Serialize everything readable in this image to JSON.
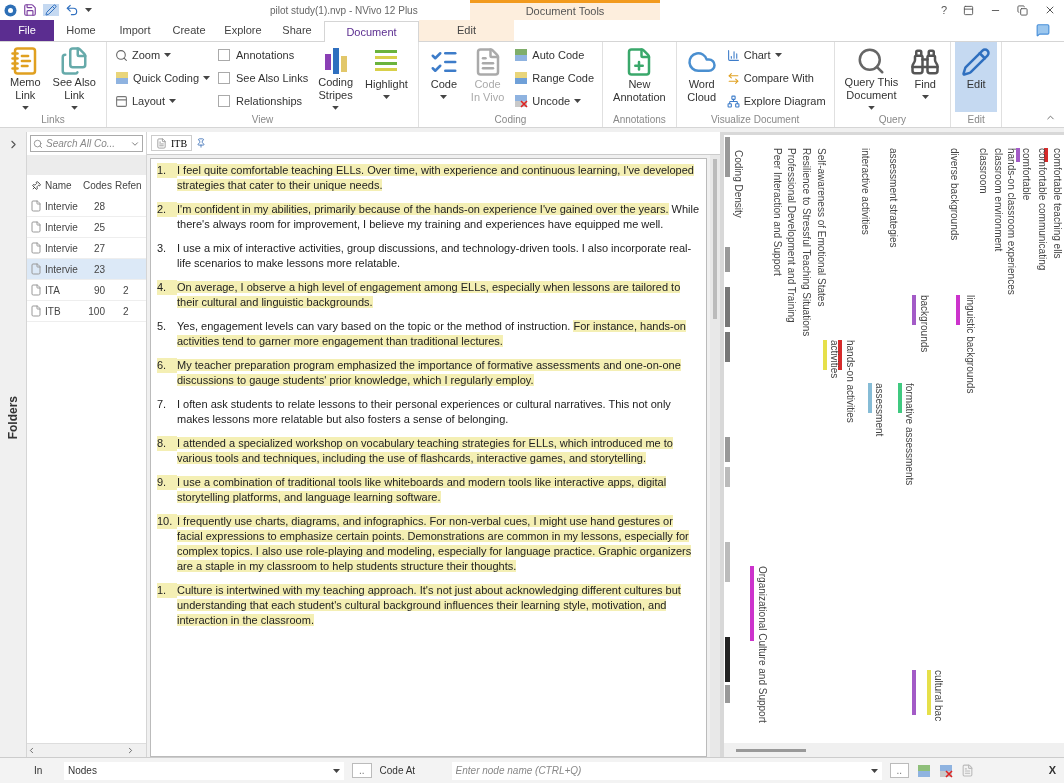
{
  "window": {
    "title": "pilot study(1).nvp - NVivo 12 Plus",
    "context_group": "Document Tools",
    "help": "?"
  },
  "tabs": [
    {
      "label": "File",
      "kind": "file",
      "selected": false
    },
    {
      "label": "Home",
      "kind": "main",
      "selected": false
    },
    {
      "label": "Import",
      "kind": "main",
      "selected": false
    },
    {
      "label": "Create",
      "kind": "main",
      "selected": false
    },
    {
      "label": "Explore",
      "kind": "main",
      "selected": false
    },
    {
      "label": "Share",
      "kind": "main",
      "selected": false
    },
    {
      "label": "Document",
      "kind": "context",
      "selected": true
    },
    {
      "label": "Edit",
      "kind": "context",
      "selected": false
    }
  ],
  "ribbon": {
    "groups": [
      {
        "label": "Links",
        "items": [
          {
            "kind": "large",
            "lines": [
              "Memo",
              "Link"
            ],
            "dropdown": true,
            "disabled": false,
            "active": false
          },
          {
            "kind": "large",
            "lines": [
              "See Also",
              "Link"
            ],
            "dropdown": true,
            "disabled": false,
            "active": false
          }
        ]
      },
      {
        "label": "View",
        "items": [
          {
            "kind": "stack",
            "items": [
              {
                "kind": "small",
                "label": "Zoom",
                "dropdown": true
              },
              {
                "kind": "small",
                "label": "Quick Coding",
                "dropdown": true
              },
              {
                "kind": "small",
                "label": "Layout",
                "dropdown": true
              }
            ]
          },
          {
            "kind": "stack",
            "items": [
              {
                "kind": "check",
                "label": "Annotations",
                "checked": false
              },
              {
                "kind": "check",
                "label": "See Also Links",
                "checked": false
              },
              {
                "kind": "check",
                "label": "Relationships",
                "checked": false
              }
            ]
          },
          {
            "kind": "large",
            "lines": [
              "Coding",
              "Stripes"
            ],
            "dropdown": true,
            "disabled": false,
            "active": false
          },
          {
            "kind": "large",
            "lines": [
              "Highlight"
            ],
            "dropdown": true,
            "disabled": false,
            "active": false
          }
        ]
      },
      {
        "label": "Coding",
        "items": [
          {
            "kind": "large",
            "lines": [
              "Code"
            ],
            "dropdown": true,
            "disabled": false,
            "active": false
          },
          {
            "kind": "large",
            "lines": [
              "Code",
              "In Vivo"
            ],
            "dropdown": false,
            "disabled": true,
            "active": false
          },
          {
            "kind": "stack",
            "items": [
              {
                "kind": "small",
                "label": "Auto Code",
                "dropdown": false
              },
              {
                "kind": "small",
                "label": "Range Code",
                "dropdown": false
              },
              {
                "kind": "small",
                "label": "Uncode",
                "dropdown": true
              }
            ]
          }
        ]
      },
      {
        "label": "Annotations",
        "items": [
          {
            "kind": "large",
            "lines": [
              "New",
              "Annotation"
            ],
            "dropdown": false,
            "disabled": false,
            "active": false
          }
        ]
      },
      {
        "label": "Visualize Document",
        "items": [
          {
            "kind": "large",
            "lines": [
              "Word",
              "Cloud"
            ],
            "dropdown": false,
            "disabled": false,
            "active": false
          },
          {
            "kind": "stack",
            "items": [
              {
                "kind": "small",
                "label": "Chart",
                "dropdown": true
              },
              {
                "kind": "small",
                "label": "Compare With",
                "dropdown": false
              },
              {
                "kind": "small",
                "label": "Explore Diagram",
                "dropdown": false
              }
            ]
          }
        ]
      },
      {
        "label": "Query",
        "items": [
          {
            "kind": "large",
            "lines": [
              "Query This",
              "Document"
            ],
            "dropdown": true,
            "disabled": false,
            "active": false
          },
          {
            "kind": "large",
            "lines": [
              "Find"
            ],
            "dropdown": true,
            "disabled": false,
            "active": false
          }
        ]
      },
      {
        "label": "Edit",
        "items": [
          {
            "kind": "large",
            "lines": [
              "Edit"
            ],
            "dropdown": false,
            "disabled": false,
            "active": true
          }
        ]
      }
    ]
  },
  "side_strip": {
    "label": "Folders"
  },
  "files": {
    "search": {
      "placeholder": "Search All Co..."
    },
    "columns": [
      "Name",
      "Codes",
      "Refen"
    ],
    "rows": [
      {
        "name": "Intervie",
        "codes": "28",
        "selected": false
      },
      {
        "name": "Intervie",
        "codes": "25",
        "selected": false
      },
      {
        "name": "Intervie",
        "codes": "27",
        "selected": false
      },
      {
        "name": "Intervie",
        "codes": "23",
        "selected": true
      },
      {
        "name": "ITA",
        "codes": "90",
        "refs": "2",
        "selected": false
      },
      {
        "name": "ITB",
        "codes": "100",
        "refs": "2",
        "selected": false
      }
    ]
  },
  "document": {
    "tab": "ITB",
    "paragraphs": [
      {
        "number": "1.",
        "segments": [
          {
            "text": "I feel quite comfortable teaching ELLs. Over time, with experience and continuous learning, I've developed strategies that cater to their unique needs.",
            "highlighted": true
          }
        ]
      },
      {
        "number": "2.",
        "segments": [
          {
            "text": "I'm confident in my abilities, primarily because of the hands-on experience I've gained over the years.",
            "highlighted": true
          },
          {
            "text": " While there's always room for improvement, I believe my training and experiences have equipped me well.",
            "highlighted": false
          }
        ]
      },
      {
        "number": "3.",
        "segments": [
          {
            "text": "I use a mix of interactive activities, group discussions, and technology-driven tools. I also incorporate real-life scenarios to make lessons more relatable.",
            "highlighted": false
          }
        ]
      },
      {
        "number": "4.",
        "segments": [
          {
            "text": "On average, I observe a high level of engagement among ELLs, especially when lessons are tailored to their cultural and linguistic backgrounds.",
            "highlighted": true
          }
        ]
      },
      {
        "number": "5.",
        "segments": [
          {
            "text": "Yes, engagement levels can vary based on the topic or the method of instruction. ",
            "highlighted": false
          },
          {
            "text": "For instance, hands-on activities tend to garner more engagement than traditional lectures.",
            "highlighted": true
          }
        ]
      },
      {
        "number": "6.",
        "segments": [
          {
            "text": "My teacher preparation program emphasized the importance of formative assessments and one-on-one discussions to gauge students' prior knowledge, which I regularly employ.",
            "highlighted": true
          }
        ]
      },
      {
        "number": "7.",
        "segments": [
          {
            "text": "I often ask students to relate lessons to their personal experiences or cultural narratives. This not only makes lessons more relatable but also fosters a sense of belonging.",
            "highlighted": false
          }
        ]
      },
      {
        "number": "8.",
        "segments": [
          {
            "text": "I attended a specialized workshop on vocabulary teaching strategies for ELLs, which introduced me to various tools and techniques, including the use of flashcards, interactive games, and storytelling.",
            "highlighted": true
          }
        ]
      },
      {
        "number": "9.",
        "segments": [
          {
            "text": "I use a combination of traditional tools like whiteboards and modern tools like interactive apps, digital storytelling platforms, and language learning software.",
            "highlighted": true
          }
        ]
      },
      {
        "number": "10.",
        "segments": [
          {
            "text": "I frequently use charts, diagrams, and infographics. For non-verbal cues, I might use hand gestures or facial expressions to emphasize certain points. Demonstrations are common in my lessons, especially for complex topics. I also use role-playing and modeling, especially for language practice. Graphic organizers are a staple in my classroom to help students structure their thoughts.",
            "highlighted": true
          }
        ]
      },
      {
        "number": "1.",
        "segments": [
          {
            "text": "Culture is intertwined with my teaching approach.",
            "highlighted": true
          },
          {
            "text": " It's not just about acknowledging different cultures but understanding that each student's cultural background influences their learning style, motivation, and interaction in the classroom.",
            "highlighted": true
          }
        ]
      }
    ]
  },
  "stripes": {
    "density_label": "Coding Density",
    "nodes": [
      {
        "label": "comfortable teaching ells",
        "color": "#d62a2a"
      },
      {
        "label": "comfortable communicating"
      },
      {
        "label": "comfortable",
        "color": "#a35bc7"
      },
      {
        "label": "hands-on classroom experiences"
      },
      {
        "label": "classroom environment"
      },
      {
        "label": "classroom"
      },
      {
        "label": "diverse backgrounds"
      },
      {
        "label": "assessment strategies"
      },
      {
        "label": "interactive activities"
      },
      {
        "label": "Self-awareness of Emotional States"
      },
      {
        "label": "Resilience to Stressful Teaching Situations"
      },
      {
        "label": "Professional Development and Training"
      },
      {
        "label": "Peer Interaction and Support"
      },
      {
        "label": "linguistic backgrounds",
        "color": "#cc33cc"
      },
      {
        "label": "backgrounds",
        "color": "#a35bc7"
      },
      {
        "label": "hands-on activities",
        "color": "#d62a2a"
      },
      {
        "label": "activities",
        "color": "#e6e04a"
      },
      {
        "label": "formative assessments",
        "color": "#40c980"
      },
      {
        "label": "assessment",
        "color": "#86bcd6"
      },
      {
        "label": "Organizational Culture and Support",
        "color": "#cc33cc"
      },
      {
        "label": "cultural bac",
        "color": "#e6e04a"
      },
      {
        "color": "#a35bc7"
      }
    ]
  },
  "bottom_bar": {
    "in_label": "In",
    "in_value": "Nodes",
    "browse": "..",
    "code_at_label": "Code At",
    "node_placeholder": "Enter node name (CTRL+Q)",
    "browse_2": "..",
    "close": "X"
  }
}
